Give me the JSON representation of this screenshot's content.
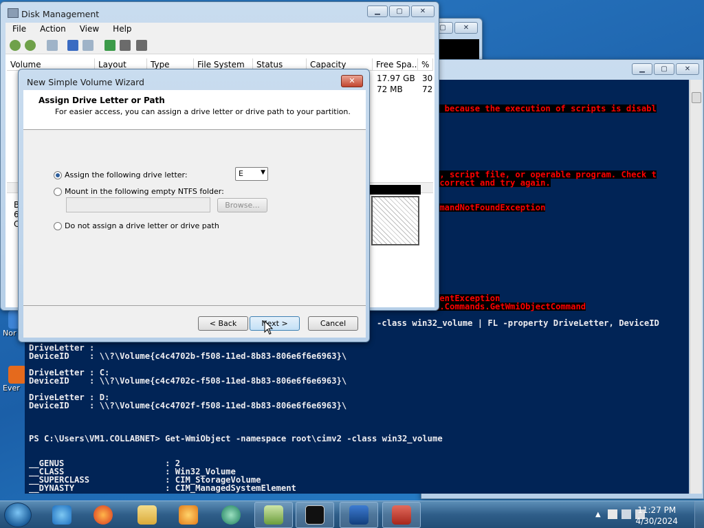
{
  "desktop": {
    "icons": [
      {
        "label": "Nor"
      },
      {
        "label": "Ever"
      }
    ]
  },
  "powershell": {
    "errors": [
      "d because the execution of scripts is disabl",
      "n, script file, or operable program. Check t",
      " correct and try again.",
      "mmandNotFoundException",
      "mentException",
      "l.Commands.GetWmiObjectCommand"
    ],
    "lines": [
      "-class win32_volume | FL -property DriveLetter, DeviceID",
      "DriveLetter :",
      "DeviceID    : \\\\?\\Volume{c4c4702b-f508-11ed-8b83-806e6f6e6963}\\",
      "DriveLetter : C:",
      "DeviceID    : \\\\?\\Volume{c4c4702c-f508-11ed-8b83-806e6f6e6963}\\",
      "DriveLetter : D:",
      "DeviceID    : \\\\?\\Volume{c4c4702f-f508-11ed-8b83-806e6f6e6963}\\",
      "PS C:\\Users\\VM1.COLLABNET> Get-WmiObject -namespace root\\cimv2 -class win32_volume",
      "__GENUS                    : 2",
      "__CLASS                    : Win32_Volume",
      "__SUPERCLASS               : CIM_StorageVolume",
      "__DYNASTY                  : CIM_ManagedSystemElement"
    ]
  },
  "disk_management": {
    "title": "Disk Management",
    "menu": [
      "File",
      "Action",
      "View",
      "Help"
    ],
    "columns": [
      "Volume",
      "Layout",
      "Type",
      "File System",
      "Status",
      "Capacity",
      "Free Spa...",
      "% F"
    ],
    "rows": [
      {
        "free": "17.97 GB",
        "pct": "30"
      },
      {
        "free": "72 MB",
        "pct": "72"
      }
    ],
    "lower_letters": [
      "B",
      "6",
      "C"
    ]
  },
  "wizard": {
    "title": "New Simple Volume Wizard",
    "heading": "Assign Drive Letter or Path",
    "subheading": "For easier access, you can assign a drive letter or drive path to your partition.",
    "option_assign": "Assign the following drive letter:",
    "drive_letter": "E",
    "option_mount": "Mount in the following empty NTFS folder:",
    "browse": "Browse...",
    "option_none": "Do not assign a drive letter or drive path",
    "back": "< Back",
    "next": "Next >",
    "cancel": "Cancel"
  },
  "taskbar": {
    "time": "11:27 PM",
    "date": "4/30/2024"
  },
  "colors": {
    "ps_background": "#012456",
    "ps_error": "#ff0000",
    "desktop": "#1b5fa8"
  }
}
